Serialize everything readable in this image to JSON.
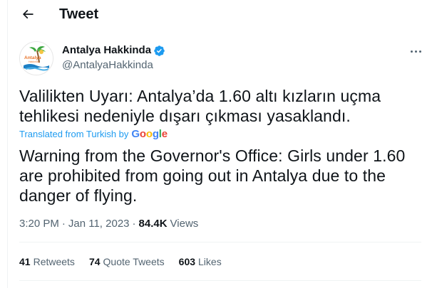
{
  "header": {
    "title": "Tweet",
    "back_icon": "arrow-left-icon"
  },
  "author": {
    "name": "Antalya Hakkinda",
    "handle": "@AntalyaHakkinda",
    "verified": true,
    "avatar_logo_text": "Antalya Hakkında"
  },
  "tweet": {
    "text": "Valilikten Uyarı: Antalya’da 1.60 altı kızların uçma tehlikesi nedeniyle dışarı çıkması yasaklandı.",
    "translated_label": "Translated from Turkish by",
    "translation_provider": "Google",
    "translation": "Warning from the Governor's Office: Girls under 1.60 are prohibited from going out in Antalya due to the danger of flying."
  },
  "meta": {
    "time": "3:20 PM",
    "date": "Jan 11, 2023",
    "views_count": "84.4K",
    "views_label": "Views"
  },
  "stats": {
    "retweets_count": "41",
    "retweets_label": "Retweets",
    "quotes_count": "74",
    "quotes_label": "Quote Tweets",
    "likes_count": "603",
    "likes_label": "Likes"
  },
  "colors": {
    "text": "#0f1419",
    "secondary": "#536471",
    "accent": "#1d9bf0",
    "divider": "#eff3f4",
    "google_blue": "#4285F4",
    "google_red": "#EA4335",
    "google_yellow": "#FBBC05",
    "google_green": "#34A853"
  }
}
